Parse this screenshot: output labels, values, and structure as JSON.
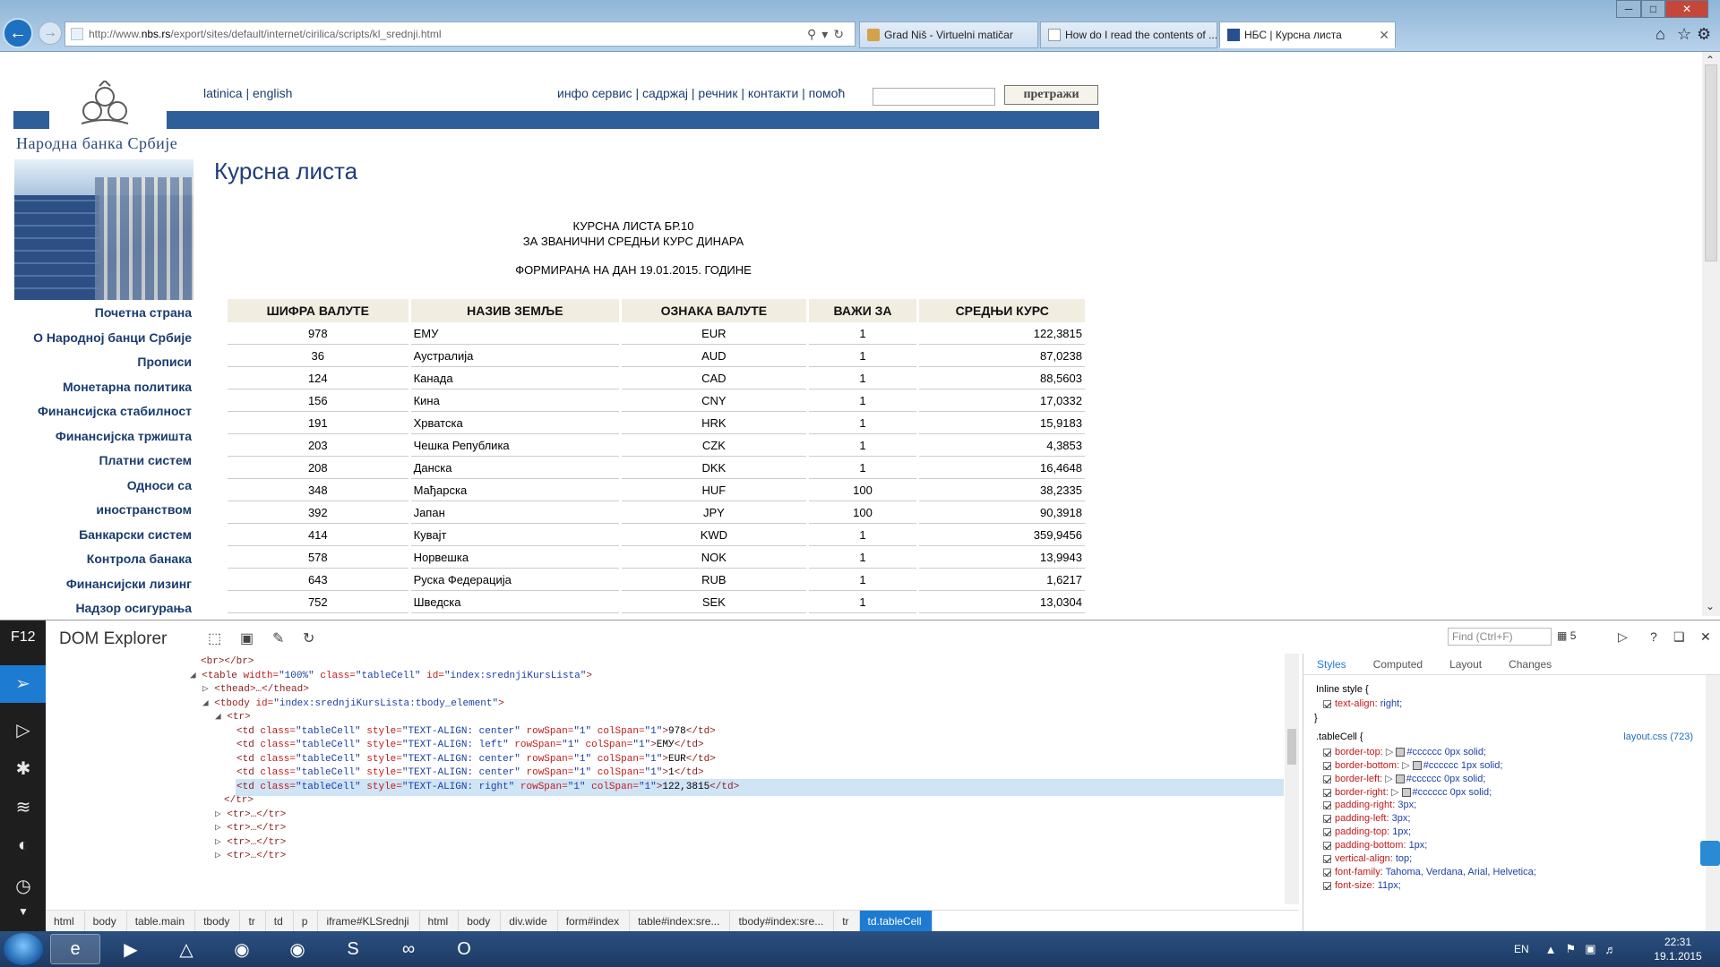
{
  "browser": {
    "url_prefix": "http://www.",
    "url_domain": "nbs.rs",
    "url_path": "/export/sites/default/internet/cirilica/scripts/kl_srednji.html",
    "tabs": [
      {
        "label": "Grad Niš - Virtuelni matičar"
      },
      {
        "label": "How do I read the contents of ..."
      },
      {
        "label": "НБС | Курсна листа"
      }
    ]
  },
  "page": {
    "logo_text": "Народна банка Србије",
    "lang_links": "latinica | english",
    "top_menu": "инфо сервис | садржај | речник | контакти | помоћ",
    "search_button": "претражи",
    "side_nav": [
      "Почетна страна",
      "О Народној банци Србије",
      "Прописи",
      "Монетарна политика",
      "Финансијска стабилност",
      "Финансијска тржишта",
      "Платни систем",
      "Односи са",
      "иностранством",
      "Банкарски систем",
      "Контрола банака",
      "Финансијски лизинг",
      "Надзор осигурања"
    ],
    "title": "Курсна листа",
    "heading_line1": "КУРСНА ЛИСТА БР.10",
    "heading_line2": "ЗА ЗВАНИЧНИ СРЕДЊИ КУРС ДИНАРА",
    "date_line": "ФОРМИРАНА НА ДАН 19.01.2015. ГОДИНЕ",
    "table": {
      "headers": [
        "ШИФРА ВАЛУТЕ",
        "НАЗИВ ЗЕМЉЕ",
        "ОЗНАКА ВАЛУТЕ",
        "ВАЖИ ЗА",
        "СРЕДЊИ КУРС"
      ],
      "rows": [
        [
          "978",
          "ЕМУ",
          "EUR",
          "1",
          "122,3815"
        ],
        [
          "36",
          "Аустралија",
          "AUD",
          "1",
          "87,0238"
        ],
        [
          "124",
          "Канада",
          "CAD",
          "1",
          "88,5603"
        ],
        [
          "156",
          "Кина",
          "CNY",
          "1",
          "17,0332"
        ],
        [
          "191",
          "Хрватска",
          "HRK",
          "1",
          "15,9183"
        ],
        [
          "203",
          "Чешка Република",
          "CZK",
          "1",
          "4,3853"
        ],
        [
          "208",
          "Данска",
          "DKK",
          "1",
          "16,4648"
        ],
        [
          "348",
          "Мађарска",
          "HUF",
          "100",
          "38,2335"
        ],
        [
          "392",
          "Јапан",
          "JPY",
          "100",
          "90,3918"
        ],
        [
          "414",
          "Кувајт",
          "KWD",
          "1",
          "359,9456"
        ],
        [
          "578",
          "Норвешка",
          "NOK",
          "1",
          "13,9943"
        ],
        [
          "643",
          "Руска Федерација",
          "RUB",
          "1",
          "1,6217"
        ],
        [
          "752",
          "Шведска",
          "SEK",
          "1",
          "13,0304"
        ]
      ]
    }
  },
  "devtools": {
    "f12_label": "F12",
    "title": "DOM Explorer",
    "find_placeholder": "Find (Ctrl+F)",
    "find_count": "5",
    "dom_lines": [
      {
        "kind": "text",
        "indent": 224,
        "text": "<br></br>"
      },
      {
        "kind": "table",
        "indent": 212
      },
      {
        "kind": "plain",
        "indent": 226,
        "tri": "▷",
        "text": "<thead>…</thead>"
      },
      {
        "kind": "tbody",
        "indent": 226
      },
      {
        "kind": "plain",
        "indent": 240,
        "tri": "◢",
        "text": "<tr>"
      },
      {
        "kind": "td",
        "indent": 264,
        "align": "center",
        "content": "978"
      },
      {
        "kind": "td",
        "indent": 264,
        "align": "left",
        "content": "ЕМУ"
      },
      {
        "kind": "td",
        "indent": 264,
        "align": "center",
        "content": "EUR"
      },
      {
        "kind": "td",
        "indent": 264,
        "align": "center",
        "content": "1"
      },
      {
        "kind": "td",
        "indent": 264,
        "align": "right",
        "content": "122,3815",
        "selected": true
      },
      {
        "kind": "plain",
        "indent": 250,
        "tri": "",
        "text": "</tr>"
      },
      {
        "kind": "plain",
        "indent": 240,
        "tri": "▷",
        "text": "<tr>…</tr>"
      },
      {
        "kind": "plain",
        "indent": 240,
        "tri": "▷",
        "text": "<tr>…</tr>"
      },
      {
        "kind": "plain",
        "indent": 240,
        "tri": "▷",
        "text": "<tr>…</tr>"
      },
      {
        "kind": "plain",
        "indent": 240,
        "tri": "▷",
        "text": "<tr>…</tr>"
      }
    ],
    "dom_strings": {
      "table_open": "<table ",
      "width_attr": "width=",
      "width_val": "\"100%\"",
      "class_attr": "class=",
      "class_val": "\"tableCell\"",
      "id_attr": "id=",
      "table_id": "\"index:srednjiKursLista\"",
      "tbody_open": "<tbody ",
      "tbody_id": "\"index:srednjiKursLista:tbody_element\"",
      "td_open": "<td ",
      "style_attr": "style=",
      "rowspan_attr": "rowSpan=",
      "colspan_attr": "colSpan=",
      "one_val": "\"1\"",
      "td_close": "</td>",
      "gt": ">"
    },
    "breadcrumb": [
      "html",
      "body",
      "table.main",
      "tbody",
      "tr",
      "td",
      "p",
      "iframe#KLSrednji",
      "html",
      "body",
      "div.wide",
      "form#index",
      "table#index:sre...",
      "tbody#index:sre...",
      "tr",
      "td.tableCell"
    ],
    "styles_tabs": [
      "Styles",
      "Computed",
      "Layout",
      "Changes"
    ],
    "inline_style_head": "Inline style  {",
    "inline_prop_name": "text-align:",
    "inline_prop_value": "right;",
    "close_brace": "}",
    "rule_head": ".tableCell  {",
    "rule_source": "layout.css (723)",
    "rule_props": [
      {
        "name": "border-top:",
        "value": "#cccccc 0px solid;",
        "swatch": true
      },
      {
        "name": "border-bottom:",
        "value": "#cccccc 1px solid;",
        "swatch": true
      },
      {
        "name": "border-left:",
        "value": "#cccccc 0px solid;",
        "swatch": true
      },
      {
        "name": "border-right:",
        "value": "#cccccc 0px solid;",
        "swatch": true
      },
      {
        "name": "padding-right:",
        "value": "3px;"
      },
      {
        "name": "padding-left:",
        "value": "3px;"
      },
      {
        "name": "padding-top:",
        "value": "1px;"
      },
      {
        "name": "padding-bottom:",
        "value": "1px;"
      },
      {
        "name": "vertical-align:",
        "value": "top;"
      },
      {
        "name": "font-family:",
        "value": "Tahoma, Verdana, Arial, Helvetica;"
      },
      {
        "name": "font-size:",
        "value": "11px;"
      }
    ]
  },
  "taskbar": {
    "language": "EN",
    "time": "22:31",
    "date": "19.1.2015"
  },
  "colors": {
    "nbs_blue": "#2e5f9a",
    "header_beige": "#f1ede1",
    "devtools_accent": "#1e7bd2"
  }
}
